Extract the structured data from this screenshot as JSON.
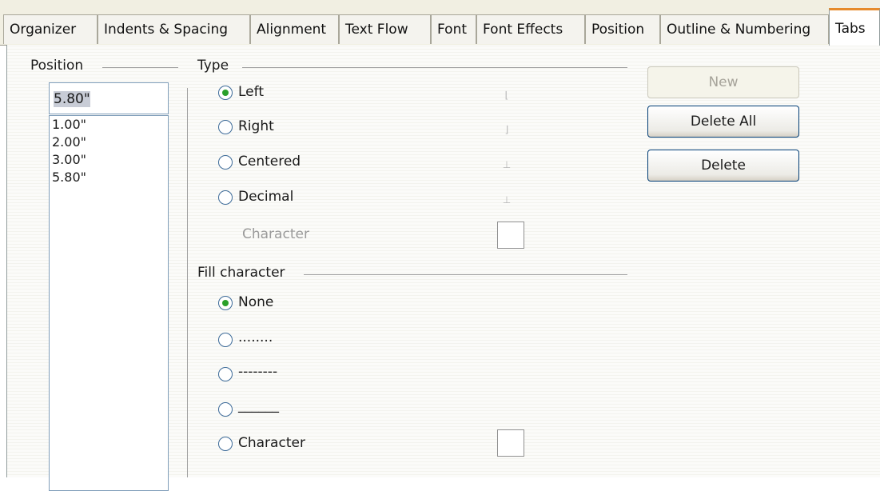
{
  "tabs": [
    "Organizer",
    "Indents & Spacing",
    "Alignment",
    "Text Flow",
    "Font",
    "Font Effects",
    "Position",
    "Outline & Numbering",
    "Tabs"
  ],
  "position": {
    "label": "Position",
    "value": "5.80\"",
    "items": [
      "1.00\"",
      "2.00\"",
      "3.00\"",
      "5.80\""
    ]
  },
  "type": {
    "label": "Type",
    "options": [
      {
        "label": "Left",
        "checked": true,
        "icon": "tab-left-icon"
      },
      {
        "label": "Right",
        "checked": false,
        "icon": "tab-right-icon"
      },
      {
        "label": "Centered",
        "checked": false,
        "icon": "tab-center-icon"
      },
      {
        "label": "Decimal",
        "checked": false,
        "icon": "tab-decimal-icon"
      }
    ],
    "character_label": "Character"
  },
  "fill": {
    "label": "Fill character",
    "options": [
      {
        "label": "None",
        "checked": true
      },
      {
        "label": "........",
        "checked": false
      },
      {
        "label": "--------",
        "checked": false
      },
      {
        "label": "______",
        "checked": false
      },
      {
        "label": "Character",
        "checked": false
      }
    ]
  },
  "buttons": {
    "new_label": "New",
    "delete_all_label": "Delete All",
    "delete_label": "Delete"
  }
}
